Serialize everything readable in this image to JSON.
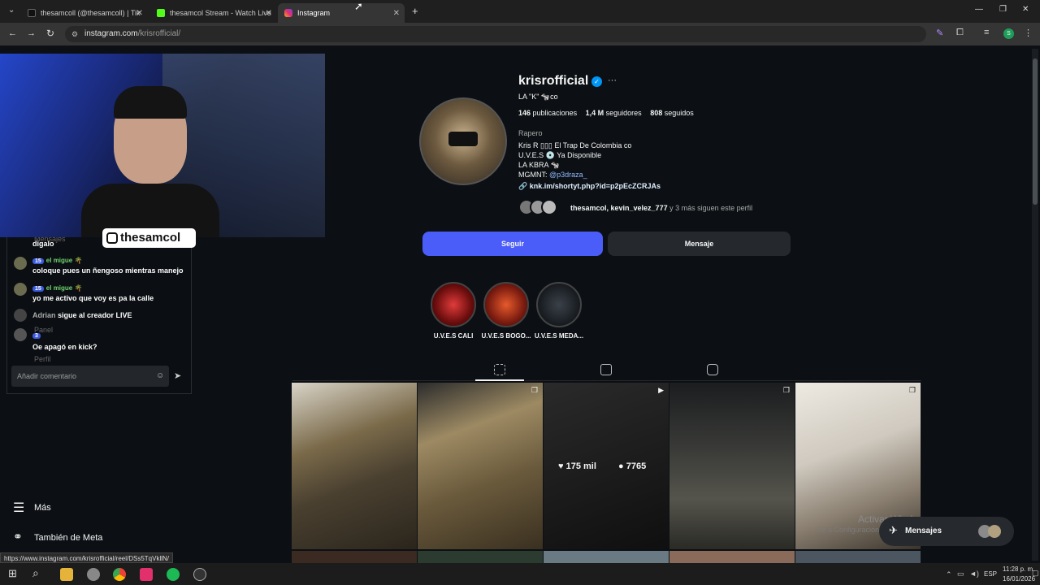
{
  "browser": {
    "tabs": [
      {
        "label": "thesamcoll (@thesamcoll) | Tik"
      },
      {
        "label": "thesamcol Stream - Watch Live"
      },
      {
        "label": "Instagram"
      }
    ],
    "new_tab": "+",
    "url_host": "instagram.com",
    "url_path": "/krisrofficial/",
    "status_url": "https://www.instagram.com/krisrofficial/reel/DSs5TqVkllN/",
    "profile_initial": "S"
  },
  "profile": {
    "username": "krisrofficial",
    "display_line": "LA \"K\" 🐄co",
    "posts_count": "146",
    "posts_label": "publicaciones",
    "followers_count": "1,4 M",
    "followers_label": "seguidores",
    "following_count": "808",
    "following_label": "seguidos",
    "category": "Rapero",
    "bio_lines": [
      "Kris R ▯▯▯ El Trap De Colombia co",
      "U.V.E.S 💿 Ya Disponible",
      "LA KBRA 🐄",
      "MGMNT: "
    ],
    "mgmnt_handle": "@p3draza_",
    "link": "knk.im/shortyt.php?id=p2pEcZCRJAs",
    "followed_by_names": "thesamcol, kevin_velez_777",
    "followed_by_rest": " y 3 más siguen este perfil",
    "follow_button": "Seguir",
    "message_button": "Mensaje",
    "highlights": [
      {
        "label": "U.V.E.S CALI"
      },
      {
        "label": "U.V.E.S BOGO..."
      },
      {
        "label": "U.V.E.S MEDA..."
      }
    ],
    "hovered_post": {
      "likes": "175 mil",
      "comments": "7765"
    }
  },
  "sidebar": {
    "more": "Más",
    "meta": "También de Meta",
    "messages_float": "Mensajes",
    "hidden_items": [
      "Mensajes",
      "Panel",
      "Perfil"
    ]
  },
  "chat": {
    "first_line": "dígalo",
    "messages": [
      {
        "badge": "15",
        "user": "el migue 🌴",
        "text": "coloque pues un ñengoso mientras manejo"
      },
      {
        "badge": "15",
        "user": "el migue 🌴",
        "text": "yo me activo que voy es pa la calle"
      },
      {
        "badge": "",
        "user": "Adrian",
        "text": "sigue al creador LIVE"
      },
      {
        "badge": "3",
        "user": "",
        "text": "Oe apagó en kick?"
      }
    ],
    "comment_placeholder": "Añadir comentario"
  },
  "stream_overlay": {
    "ig_tag": "thesamcol"
  },
  "watermark": [
    "Activar Windows",
    "Ve a Configuración para activar Windows."
  ],
  "taskbar": {
    "time": "11:28 p. m.",
    "date": "16/01/2026",
    "lang": "ESP"
  },
  "colors": {
    "accent": "#4a5df9",
    "bg": "#0c1014",
    "secondary_btn": "#25292e"
  }
}
